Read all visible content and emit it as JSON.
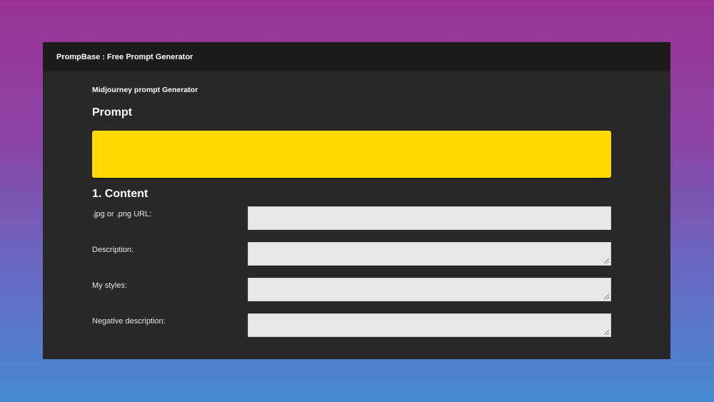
{
  "app": {
    "title": "PrompBase : Free Prompt Generator"
  },
  "generator": {
    "subtitle": "Midjourney prompt Generator",
    "prompt_heading": "Prompt",
    "prompt_value": ""
  },
  "content_section": {
    "heading": "1. Content",
    "fields": [
      {
        "label": ".jpg or .png URL:",
        "value": ""
      },
      {
        "label": "Description:",
        "value": ""
      },
      {
        "label": "My styles:",
        "value": ""
      },
      {
        "label": "Negative description:",
        "value": ""
      }
    ]
  },
  "colors": {
    "prompt_box": "#ffd900",
    "window_bg": "#282828",
    "topbar_bg": "#1c1c1c",
    "field_bg": "#e8e8e8"
  }
}
